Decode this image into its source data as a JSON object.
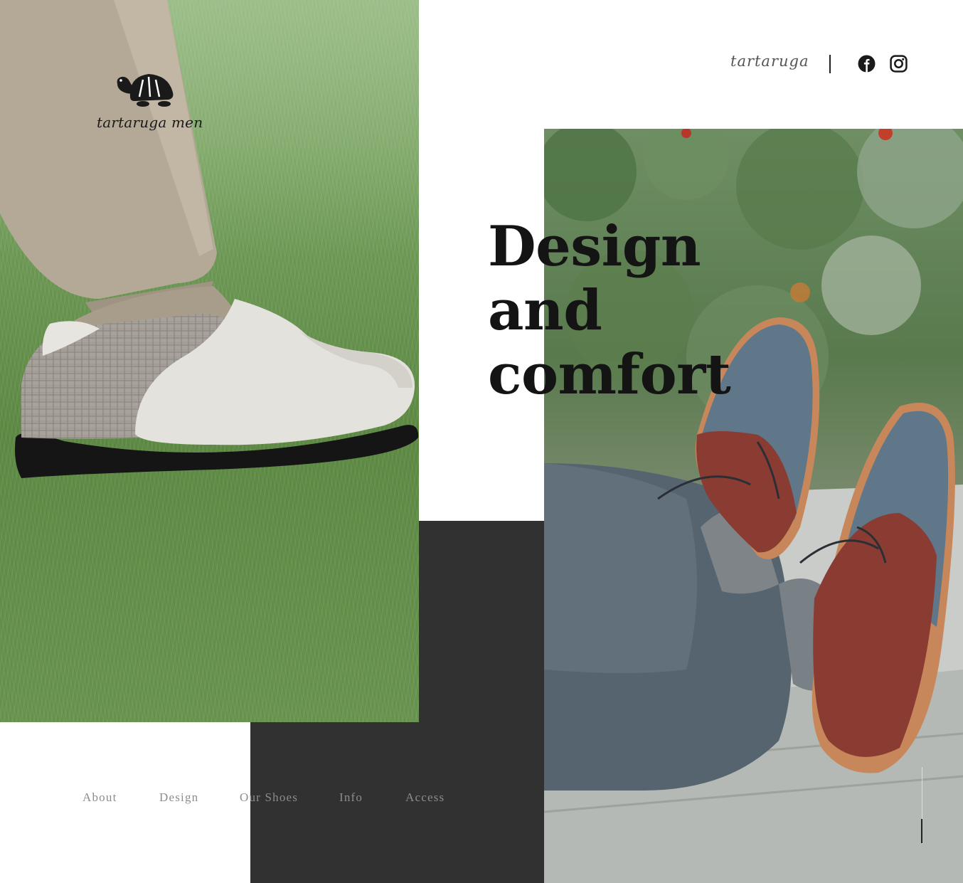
{
  "brand": {
    "logo_text": "tartaruga men",
    "header_name": "tartaruga"
  },
  "social": [
    {
      "name": "facebook",
      "icon": "facebook-icon"
    },
    {
      "name": "instagram",
      "icon": "instagram-icon"
    }
  ],
  "hero": {
    "headline_lines": [
      "Design",
      "and",
      "comfort"
    ]
  },
  "nav": {
    "items": [
      {
        "label": "About"
      },
      {
        "label": "Design"
      },
      {
        "label": "Our Shoes"
      },
      {
        "label": "Info"
      },
      {
        "label": "Access"
      }
    ]
  },
  "colors": {
    "dark_block": "#313131",
    "nav_text": "#8c8c8c",
    "headline": "#141414",
    "background": "#ffffff"
  }
}
